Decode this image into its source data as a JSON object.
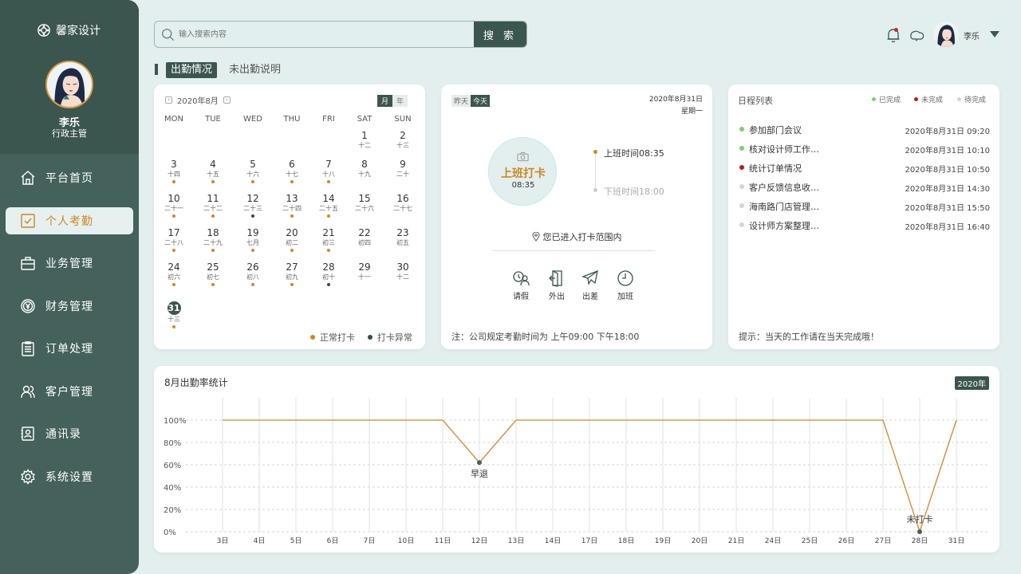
{
  "app": {
    "brand": "馨家设计"
  },
  "user": {
    "name": "李乐",
    "role": "行政主管",
    "short_name": "李乐"
  },
  "nav": {
    "items": [
      {
        "id": "home",
        "label": "平台首页",
        "icon": "home-icon"
      },
      {
        "id": "attendance",
        "label": "个人考勤",
        "icon": "checkbox-icon",
        "active": true
      },
      {
        "id": "business",
        "label": "业务管理",
        "icon": "briefcase-icon"
      },
      {
        "id": "finance",
        "label": "财务管理",
        "icon": "yen-coin-icon"
      },
      {
        "id": "orders",
        "label": "订单处理",
        "icon": "clipboard-icon"
      },
      {
        "id": "customers",
        "label": "客户管理",
        "icon": "users-icon"
      },
      {
        "id": "contacts",
        "label": "通讯录",
        "icon": "contact-card-icon"
      },
      {
        "id": "settings",
        "label": "系统设置",
        "icon": "gear-icon"
      }
    ]
  },
  "search": {
    "placeholder": "输入搜索内容",
    "button": "搜 索"
  },
  "tabs": {
    "active": "出勤情况",
    "other": "未出勤说明"
  },
  "calendar": {
    "month_label": "2020年8月",
    "view_month": "月",
    "view_year": "年",
    "weekdays": [
      "MON",
      "TUE",
      "WED",
      "THU",
      "FRI",
      "SAT",
      "SUN"
    ],
    "days": [
      {
        "n": "1",
        "l": "十二",
        "s": ""
      },
      {
        "n": "2",
        "l": "十三",
        "s": ""
      },
      {
        "n": "3",
        "l": "十四",
        "s": "normal"
      },
      {
        "n": "4",
        "l": "十五",
        "s": "normal"
      },
      {
        "n": "5",
        "l": "十六",
        "s": "normal"
      },
      {
        "n": "6",
        "l": "十七",
        "s": "normal"
      },
      {
        "n": "7",
        "l": "十八",
        "s": "normal"
      },
      {
        "n": "8",
        "l": "十九",
        "s": ""
      },
      {
        "n": "9",
        "l": "二十",
        "s": ""
      },
      {
        "n": "10",
        "l": "二十一",
        "s": "normal"
      },
      {
        "n": "11",
        "l": "二十二",
        "s": "normal"
      },
      {
        "n": "12",
        "l": "二十三",
        "s": "abnormal"
      },
      {
        "n": "13",
        "l": "二十四",
        "s": "normal"
      },
      {
        "n": "14",
        "l": "二十五",
        "s": "normal"
      },
      {
        "n": "15",
        "l": "二十六",
        "s": ""
      },
      {
        "n": "16",
        "l": "二十七",
        "s": ""
      },
      {
        "n": "17",
        "l": "二十八",
        "s": "normal"
      },
      {
        "n": "18",
        "l": "二十九",
        "s": "normal"
      },
      {
        "n": "19",
        "l": "七月",
        "s": "normal"
      },
      {
        "n": "20",
        "l": "初二",
        "s": "normal"
      },
      {
        "n": "21",
        "l": "初三",
        "s": "normal"
      },
      {
        "n": "22",
        "l": "初四",
        "s": ""
      },
      {
        "n": "23",
        "l": "初五",
        "s": ""
      },
      {
        "n": "24",
        "l": "初六",
        "s": "normal"
      },
      {
        "n": "25",
        "l": "初七",
        "s": "normal"
      },
      {
        "n": "26",
        "l": "初八",
        "s": "normal"
      },
      {
        "n": "27",
        "l": "初九",
        "s": "normal"
      },
      {
        "n": "28",
        "l": "初十",
        "s": "abnormal"
      },
      {
        "n": "29",
        "l": "十一",
        "s": ""
      },
      {
        "n": "30",
        "l": "十二",
        "s": ""
      },
      {
        "n": "31",
        "l": "十三",
        "s": "normal",
        "today": true
      }
    ],
    "first_weekday_index": 5,
    "legend_normal": "正常打卡",
    "legend_abnormal": "打卡异常",
    "colors": {
      "normal": "#d0862a",
      "abnormal": "#2f4f48"
    }
  },
  "clockin": {
    "day_prev": "昨天",
    "day_today": "今天",
    "date": "2020年8月31日",
    "weekday": "星期一",
    "action_label": "上班打卡",
    "action_time": "08:35",
    "checkin_text": "上班时间08:35",
    "checkout_text": "下班时间18:00",
    "zone_text": "您已进入打卡范围内",
    "actions": [
      {
        "label": "请假",
        "icon": "leave-icon"
      },
      {
        "label": "外出",
        "icon": "door-exit-icon"
      },
      {
        "label": "出差",
        "icon": "airplane-icon"
      },
      {
        "label": "加班",
        "icon": "clock-icon"
      }
    ],
    "note": "注：公司规定考勤时间为 上午09:00 下午18:00"
  },
  "schedule": {
    "title": "日程列表",
    "legend": [
      {
        "label": "已完成",
        "color": "#7bd16b"
      },
      {
        "label": "未完成",
        "color": "#b71c1c"
      },
      {
        "label": "待完成",
        "color": "#d5d5d5"
      }
    ],
    "items": [
      {
        "title": "参加部门会议",
        "time": "2020年8月31日 09:20",
        "status": 0
      },
      {
        "title": "核对设计师工作…",
        "time": "2020年8月31日 10:10",
        "status": 0
      },
      {
        "title": "统计订单情况",
        "time": "2020年8月31日 10:50",
        "status": 1
      },
      {
        "title": "客户反馈信息收…",
        "time": "2020年8月31日 14:30",
        "status": 2
      },
      {
        "title": "海南路门店管理…",
        "time": "2020年8月31日 15:50",
        "status": 2
      },
      {
        "title": "设计师方案整理…",
        "time": "2020年8月31日 16:40",
        "status": 2
      }
    ],
    "tip": "提示：当天的工作请在当天完成哦！"
  },
  "chart_data": {
    "type": "line",
    "title": "8月出勤率统计",
    "badge": "2020年",
    "categories": [
      "3日",
      "4日",
      "5日",
      "6日",
      "7日",
      "10日",
      "11日",
      "12日",
      "13日",
      "14日",
      "17日",
      "18日",
      "19日",
      "20日",
      "21日",
      "24日",
      "25日",
      "26日",
      "27日",
      "28日",
      "31日"
    ],
    "y_ticks": [
      "0%",
      "20%",
      "40%",
      "60%",
      "80%",
      "100%"
    ],
    "ylim": [
      0,
      100
    ],
    "series": [
      {
        "values": [
          100,
          100,
          100,
          100,
          100,
          100,
          100,
          62,
          100,
          100,
          100,
          100,
          100,
          100,
          100,
          100,
          100,
          100,
          100,
          0,
          100
        ],
        "color": "#d0862a"
      }
    ],
    "annotations": [
      {
        "index": 7,
        "label": "早退"
      },
      {
        "index": 19,
        "label": "未打卡"
      }
    ],
    "grid": true
  }
}
